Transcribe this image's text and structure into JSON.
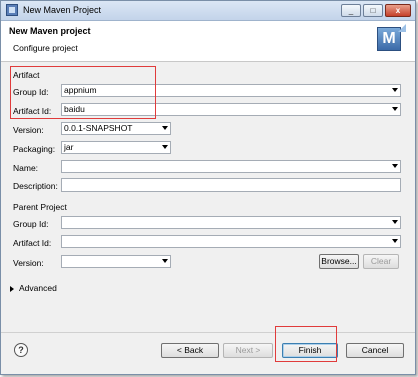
{
  "window": {
    "title": "New Maven Project"
  },
  "titlebar": {
    "minimize": "_",
    "maximize": "□",
    "close": "x"
  },
  "header": {
    "title": "New Maven project",
    "subtitle": "Configure project",
    "logo_letter": "M"
  },
  "artifact": {
    "section_label": "Artifact",
    "group_id_label": "Group Id:",
    "group_id_value": "appnium",
    "artifact_id_label": "Artifact Id:",
    "artifact_id_value": "baidu",
    "version_label": "Version:",
    "version_value": "0.0.1-SNAPSHOT",
    "packaging_label": "Packaging:",
    "packaging_value": "jar",
    "name_label": "Name:",
    "name_value": "",
    "description_label": "Description:",
    "description_value": ""
  },
  "parent": {
    "section_label": "Parent Project",
    "group_id_label": "Group Id:",
    "group_id_value": "",
    "artifact_id_label": "Artifact Id:",
    "artifact_id_value": "",
    "version_label": "Version:",
    "version_value": "",
    "browse_label": "Browse...",
    "clear_label": "Clear"
  },
  "advanced": {
    "label": "Advanced",
    "expanded": false
  },
  "footer": {
    "help_icon": "?",
    "back_label": "< Back",
    "next_label": "Next >",
    "finish_label": "Finish",
    "cancel_label": "Cancel"
  }
}
